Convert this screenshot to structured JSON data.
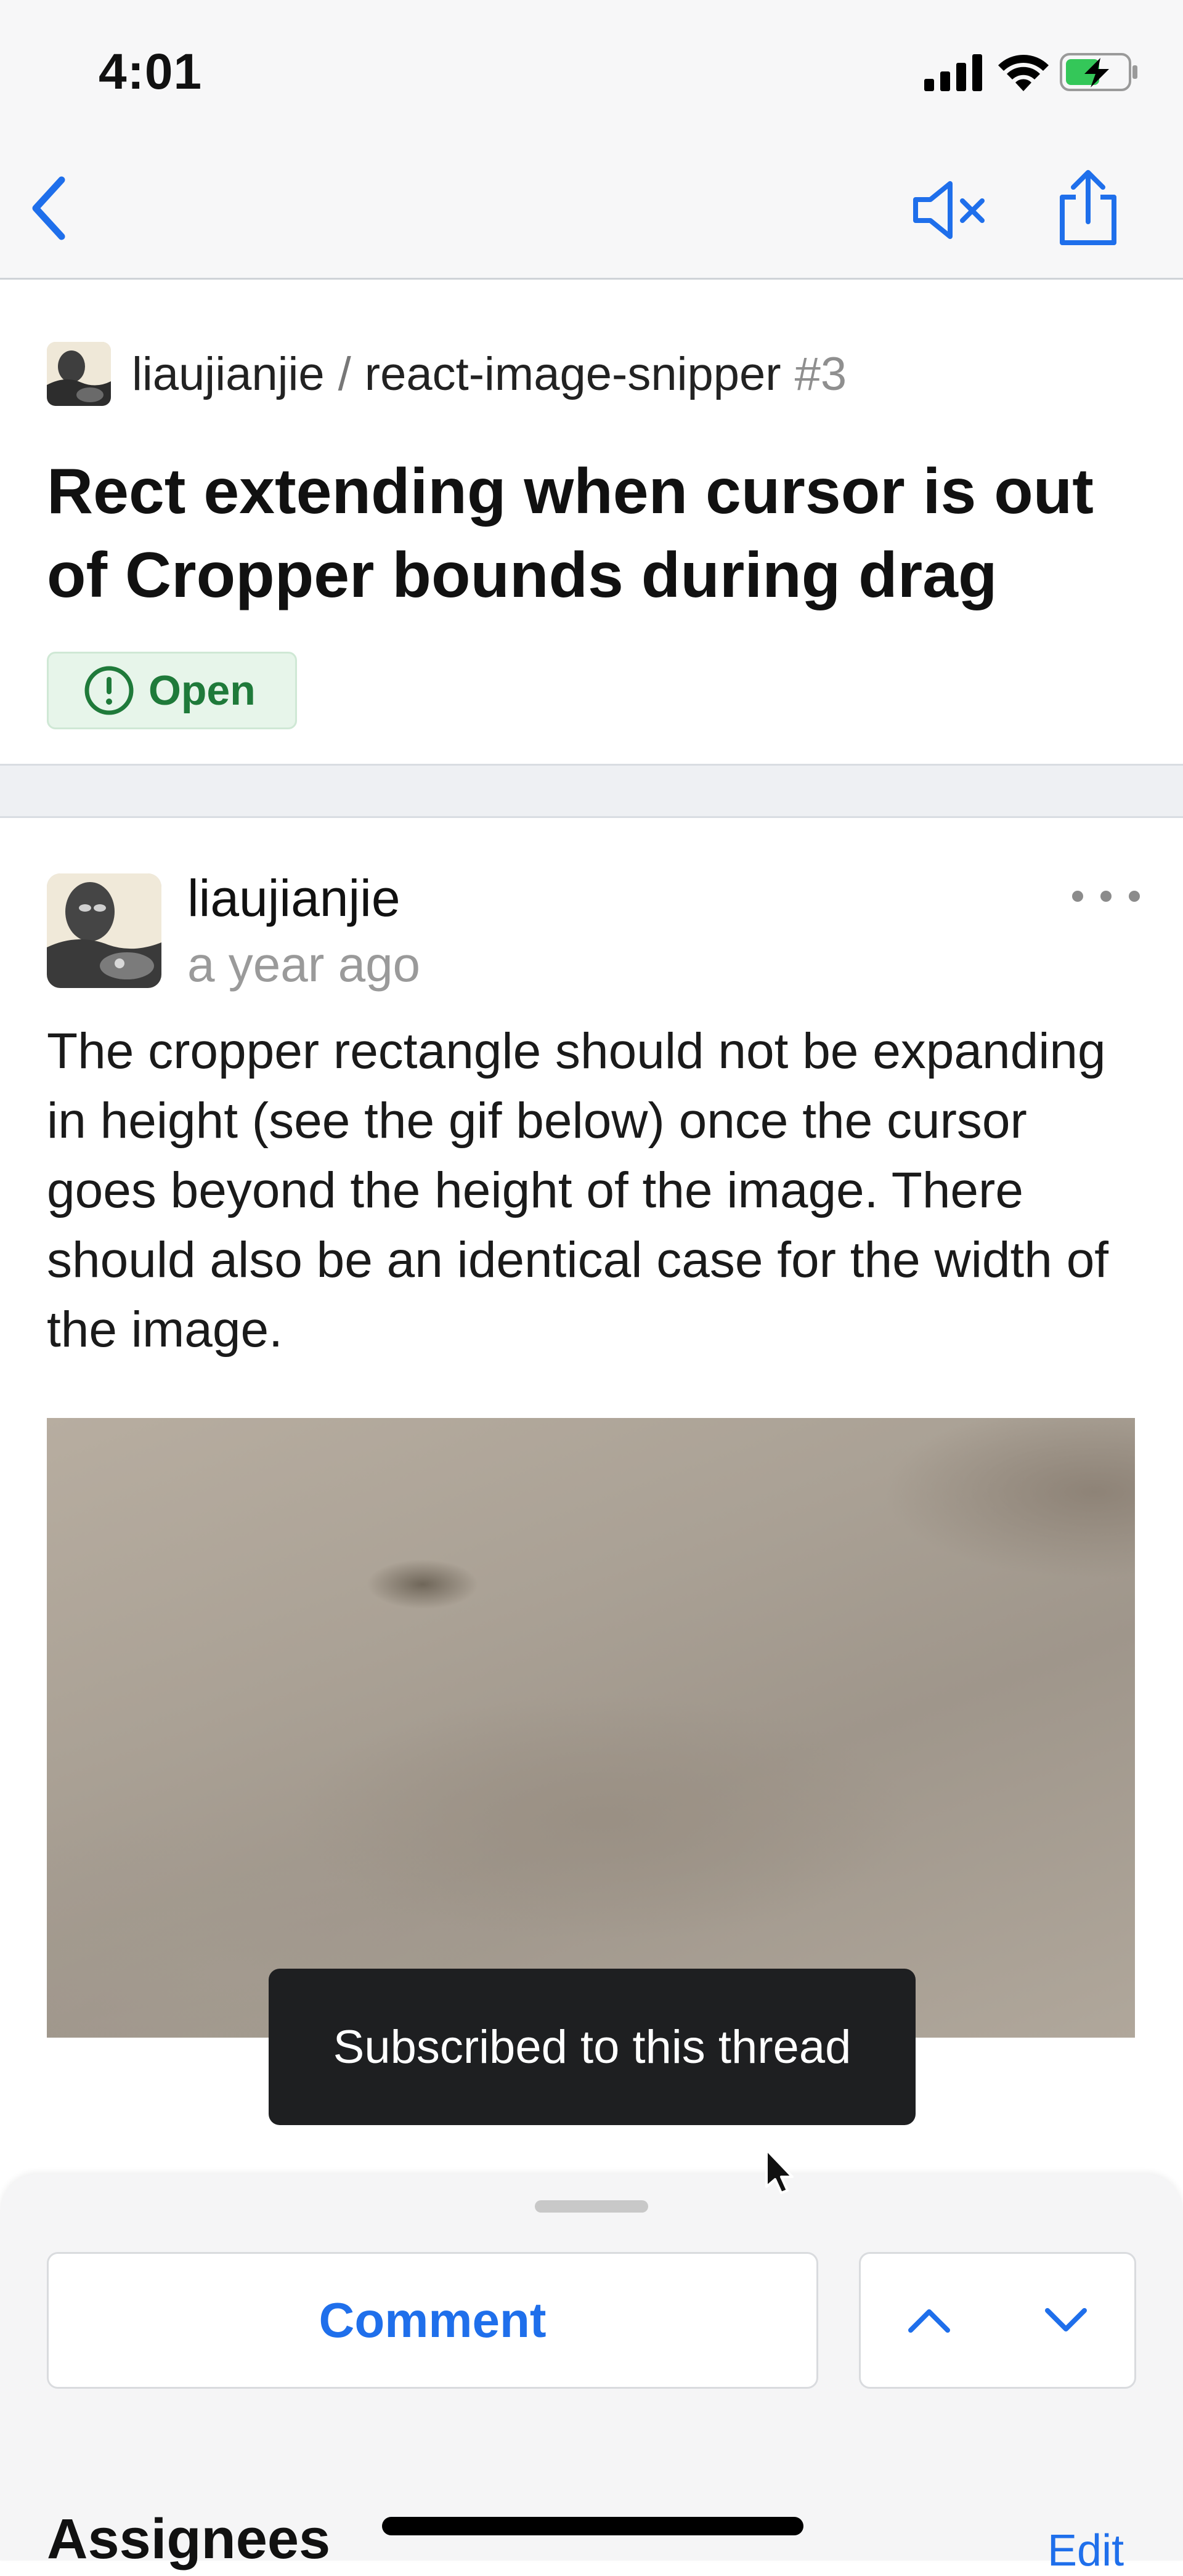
{
  "status_bar": {
    "time": "4:01"
  },
  "nav": {
    "back_icon": "chevron-left-icon",
    "mute_icon": "speaker-muted-icon",
    "share_icon": "share-icon"
  },
  "repo": {
    "owner": "liaujianjie",
    "separator": "/",
    "name": "react-image-snipper",
    "issue_number": "#3"
  },
  "issue": {
    "title": "Rect extending when cursor is out of Cropper bounds during drag",
    "status": "Open",
    "status_color": "#1f7a3a"
  },
  "comment": {
    "author": "liaujianjie",
    "time": "a year ago",
    "body": "The cropper rectangle should not be expanding in height (see the gif below) once the cursor goes beyond the height of the image. There should also be an identical case for the width of the image."
  },
  "toast": {
    "message": "Subscribed to this thread"
  },
  "bottom_sheet": {
    "comment_label": "Comment",
    "assignees_heading": "Assignees",
    "edit_label": "Edit"
  },
  "colors": {
    "accent": "#1f6feb",
    "open_green": "#1f7a3a"
  }
}
